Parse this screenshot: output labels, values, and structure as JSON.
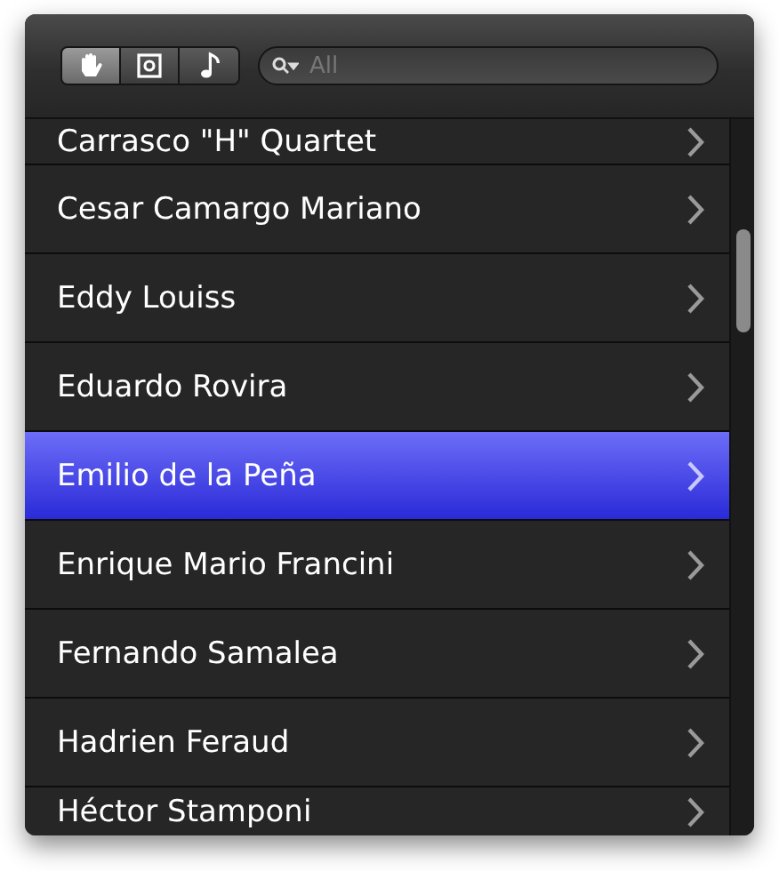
{
  "toolbar": {
    "modes": [
      {
        "kind": "hand",
        "selected": true
      },
      {
        "kind": "photo",
        "selected": false
      },
      {
        "kind": "music",
        "selected": false
      }
    ],
    "search": {
      "placeholder": "All"
    }
  },
  "list": {
    "items": [
      {
        "label": "Carrasco \"H\" Quartet",
        "selected": false
      },
      {
        "label": "Cesar Camargo Mariano",
        "selected": false
      },
      {
        "label": "Eddy Louiss",
        "selected": false
      },
      {
        "label": "Eduardo Rovira",
        "selected": false
      },
      {
        "label": "Emilio de la Peña",
        "selected": true
      },
      {
        "label": "Enrique Mario Francini",
        "selected": false
      },
      {
        "label": "Fernando Samalea",
        "selected": false
      },
      {
        "label": "Hadrien Feraud",
        "selected": false
      },
      {
        "label": "Héctor Stamponi",
        "selected": false
      }
    ]
  }
}
